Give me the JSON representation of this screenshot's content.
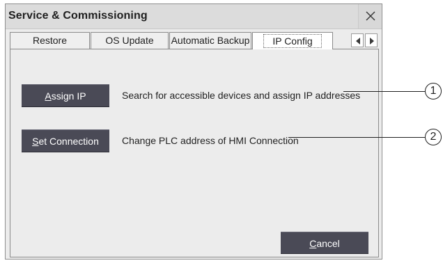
{
  "window": {
    "title": "Service & Commissioning",
    "close_icon": "close-icon"
  },
  "tabs": [
    {
      "label": "Restore",
      "active": false
    },
    {
      "label": "OS Update",
      "active": false
    },
    {
      "label": "Automatic Backup",
      "active": false
    },
    {
      "label": "IP Config",
      "active": true
    }
  ],
  "tab_nav": {
    "left_icon": "arrow-left-icon",
    "right_icon": "arrow-right-icon"
  },
  "actions": {
    "assign_ip": {
      "label_prefix": "",
      "label_underlined": "A",
      "label_rest": "ssign IP",
      "description": "Search for accessible devices and assign IP addresses",
      "callout": "1"
    },
    "set_connection": {
      "label_prefix": "",
      "label_underlined": "S",
      "label_rest": "et Connection",
      "description": "Change PLC address of HMI Connection",
      "callout": "2"
    }
  },
  "footer": {
    "cancel_underlined": "C",
    "cancel_rest": "ancel"
  },
  "colors": {
    "button_bg": "#4a4a56",
    "dialog_bg": "#ececec",
    "titlebar_bg": "#dcdcdc"
  }
}
